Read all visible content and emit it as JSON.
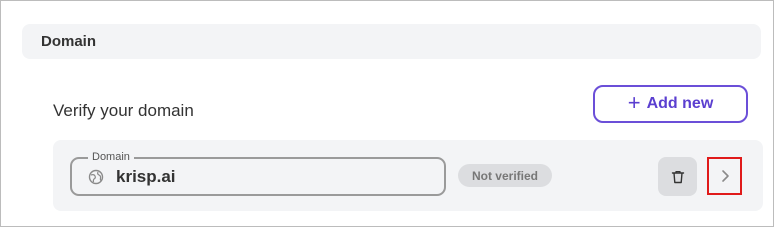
{
  "section": {
    "title": "Domain"
  },
  "verify": {
    "subtitle": "Verify your domain",
    "add_button_label": "Add new"
  },
  "domain_item": {
    "field_label": "Domain",
    "value": "krisp.ai",
    "status": "Not verified"
  },
  "icons": {
    "add": "plus-icon",
    "domain": "globe-icon",
    "delete": "trash-icon",
    "open": "chevron-right-icon"
  },
  "colors": {
    "accent": "#6b4fd8",
    "highlight_border": "#e01a1a",
    "panel_bg": "#f3f4f6",
    "badge_bg": "#dcdde0"
  }
}
